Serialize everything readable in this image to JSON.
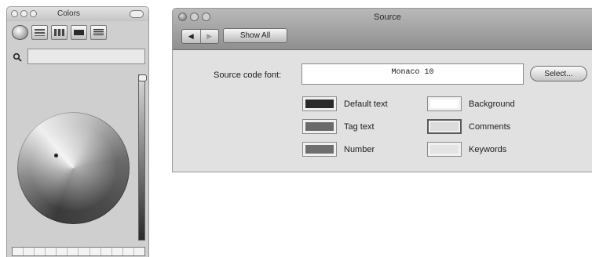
{
  "colors_panel": {
    "title": "Colors",
    "modes": [
      "color-wheel-icon",
      "color-sliders-icon",
      "color-palettes-icon",
      "image-palettes-icon",
      "crayons-icon"
    ],
    "brightness_level": 1.0,
    "swatch_count": 12
  },
  "source_window": {
    "title": "Source",
    "nav": {
      "back": "◀",
      "forward": "▶"
    },
    "show_all_label": "Show All",
    "font_label": "Source code font:",
    "font_value": "Monaco 10",
    "select_label": "Select...",
    "colors": [
      {
        "label": "Default text",
        "color": "#2a2a2a"
      },
      {
        "label": "Tag text",
        "color": "#6a6a6a"
      },
      {
        "label": "Number",
        "color": "#6e6e6e"
      },
      {
        "label": "Background",
        "color": "#ffffff"
      },
      {
        "label": "Comments",
        "color": "#dcdcdc"
      },
      {
        "label": "Keywords",
        "color": "#e4e4e4"
      }
    ]
  }
}
